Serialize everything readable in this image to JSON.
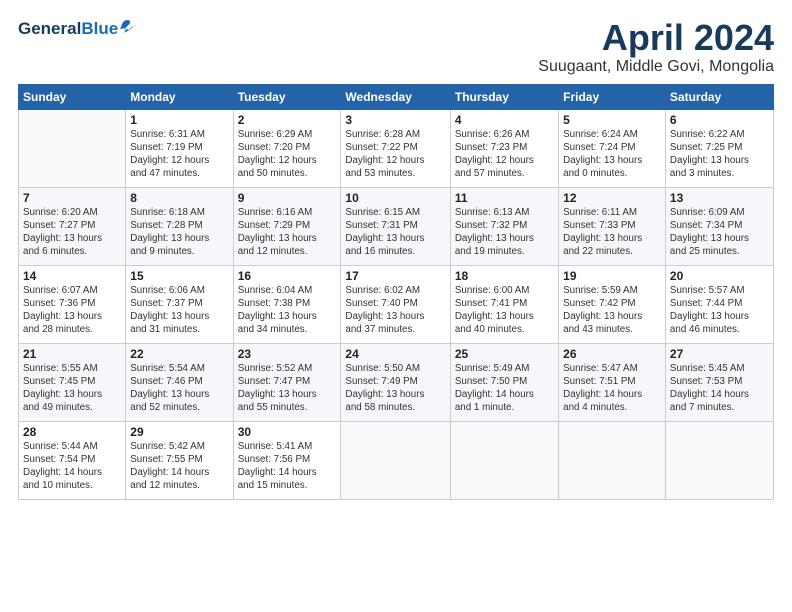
{
  "header": {
    "logo_general": "General",
    "logo_blue": "Blue",
    "month": "April 2024",
    "location": "Suugaant, Middle Govi, Mongolia"
  },
  "weekdays": [
    "Sunday",
    "Monday",
    "Tuesday",
    "Wednesday",
    "Thursday",
    "Friday",
    "Saturday"
  ],
  "weeks": [
    [
      {
        "day": "",
        "info": ""
      },
      {
        "day": "1",
        "info": "Sunrise: 6:31 AM\nSunset: 7:19 PM\nDaylight: 12 hours\nand 47 minutes."
      },
      {
        "day": "2",
        "info": "Sunrise: 6:29 AM\nSunset: 7:20 PM\nDaylight: 12 hours\nand 50 minutes."
      },
      {
        "day": "3",
        "info": "Sunrise: 6:28 AM\nSunset: 7:22 PM\nDaylight: 12 hours\nand 53 minutes."
      },
      {
        "day": "4",
        "info": "Sunrise: 6:26 AM\nSunset: 7:23 PM\nDaylight: 12 hours\nand 57 minutes."
      },
      {
        "day": "5",
        "info": "Sunrise: 6:24 AM\nSunset: 7:24 PM\nDaylight: 13 hours\nand 0 minutes."
      },
      {
        "day": "6",
        "info": "Sunrise: 6:22 AM\nSunset: 7:25 PM\nDaylight: 13 hours\nand 3 minutes."
      }
    ],
    [
      {
        "day": "7",
        "info": "Sunrise: 6:20 AM\nSunset: 7:27 PM\nDaylight: 13 hours\nand 6 minutes."
      },
      {
        "day": "8",
        "info": "Sunrise: 6:18 AM\nSunset: 7:28 PM\nDaylight: 13 hours\nand 9 minutes."
      },
      {
        "day": "9",
        "info": "Sunrise: 6:16 AM\nSunset: 7:29 PM\nDaylight: 13 hours\nand 12 minutes."
      },
      {
        "day": "10",
        "info": "Sunrise: 6:15 AM\nSunset: 7:31 PM\nDaylight: 13 hours\nand 16 minutes."
      },
      {
        "day": "11",
        "info": "Sunrise: 6:13 AM\nSunset: 7:32 PM\nDaylight: 13 hours\nand 19 minutes."
      },
      {
        "day": "12",
        "info": "Sunrise: 6:11 AM\nSunset: 7:33 PM\nDaylight: 13 hours\nand 22 minutes."
      },
      {
        "day": "13",
        "info": "Sunrise: 6:09 AM\nSunset: 7:34 PM\nDaylight: 13 hours\nand 25 minutes."
      }
    ],
    [
      {
        "day": "14",
        "info": "Sunrise: 6:07 AM\nSunset: 7:36 PM\nDaylight: 13 hours\nand 28 minutes."
      },
      {
        "day": "15",
        "info": "Sunrise: 6:06 AM\nSunset: 7:37 PM\nDaylight: 13 hours\nand 31 minutes."
      },
      {
        "day": "16",
        "info": "Sunrise: 6:04 AM\nSunset: 7:38 PM\nDaylight: 13 hours\nand 34 minutes."
      },
      {
        "day": "17",
        "info": "Sunrise: 6:02 AM\nSunset: 7:40 PM\nDaylight: 13 hours\nand 37 minutes."
      },
      {
        "day": "18",
        "info": "Sunrise: 6:00 AM\nSunset: 7:41 PM\nDaylight: 13 hours\nand 40 minutes."
      },
      {
        "day": "19",
        "info": "Sunrise: 5:59 AM\nSunset: 7:42 PM\nDaylight: 13 hours\nand 43 minutes."
      },
      {
        "day": "20",
        "info": "Sunrise: 5:57 AM\nSunset: 7:44 PM\nDaylight: 13 hours\nand 46 minutes."
      }
    ],
    [
      {
        "day": "21",
        "info": "Sunrise: 5:55 AM\nSunset: 7:45 PM\nDaylight: 13 hours\nand 49 minutes."
      },
      {
        "day": "22",
        "info": "Sunrise: 5:54 AM\nSunset: 7:46 PM\nDaylight: 13 hours\nand 52 minutes."
      },
      {
        "day": "23",
        "info": "Sunrise: 5:52 AM\nSunset: 7:47 PM\nDaylight: 13 hours\nand 55 minutes."
      },
      {
        "day": "24",
        "info": "Sunrise: 5:50 AM\nSunset: 7:49 PM\nDaylight: 13 hours\nand 58 minutes."
      },
      {
        "day": "25",
        "info": "Sunrise: 5:49 AM\nSunset: 7:50 PM\nDaylight: 14 hours\nand 1 minute."
      },
      {
        "day": "26",
        "info": "Sunrise: 5:47 AM\nSunset: 7:51 PM\nDaylight: 14 hours\nand 4 minutes."
      },
      {
        "day": "27",
        "info": "Sunrise: 5:45 AM\nSunset: 7:53 PM\nDaylight: 14 hours\nand 7 minutes."
      }
    ],
    [
      {
        "day": "28",
        "info": "Sunrise: 5:44 AM\nSunset: 7:54 PM\nDaylight: 14 hours\nand 10 minutes."
      },
      {
        "day": "29",
        "info": "Sunrise: 5:42 AM\nSunset: 7:55 PM\nDaylight: 14 hours\nand 12 minutes."
      },
      {
        "day": "30",
        "info": "Sunrise: 5:41 AM\nSunset: 7:56 PM\nDaylight: 14 hours\nand 15 minutes."
      },
      {
        "day": "",
        "info": ""
      },
      {
        "day": "",
        "info": ""
      },
      {
        "day": "",
        "info": ""
      },
      {
        "day": "",
        "info": ""
      }
    ]
  ]
}
